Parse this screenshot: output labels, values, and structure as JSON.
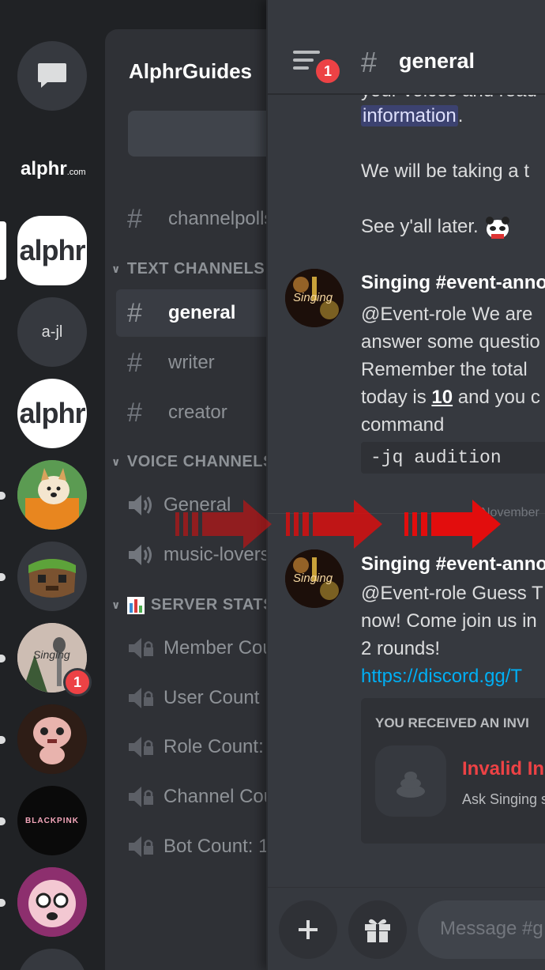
{
  "colors": {
    "accent": "#5865f2",
    "danger": "#ed4245",
    "link": "#00aff4",
    "arrow": "#e20d0d"
  },
  "rail": {
    "dm_icon": "chat-bubble-icon",
    "logo_small": "alphr",
    "logo_small_sub": ".com",
    "servers": [
      {
        "label": "alphr"
      },
      {
        "label": "a-jl"
      },
      {
        "label": "alphr"
      },
      {
        "label": ""
      },
      {
        "label": ""
      },
      {
        "label": "Singing",
        "badge": "1"
      },
      {
        "label": ""
      },
      {
        "label": "BLACKPINK"
      },
      {
        "label": ""
      }
    ]
  },
  "sidebar": {
    "guild_name": "AlphrGuides",
    "top_channel": "channelpolls",
    "categories": {
      "text": "TEXT CHANNELS",
      "voice": "VOICE CHANNELS",
      "stats": "SERVER STATS"
    },
    "text_channels": [
      "general",
      "writer",
      "creator"
    ],
    "voice_channels": [
      "General",
      "music-lovers"
    ],
    "stat_channels": [
      "Member Count",
      "User Count",
      "Role Count:",
      "Channel Count",
      "Bot Count: 1"
    ]
  },
  "chat": {
    "unread_badge": "1",
    "channel": "general",
    "messages_top": {
      "partial_line": "your voices and read",
      "information": "information",
      "period": ".",
      "line2": "We will be taking a t",
      "line3": "See y'all later."
    },
    "message1": {
      "author": "Singing #event-anno",
      "avatar_text": "Singing",
      "lines": [
        "@Event-role We are",
        "answer some questio",
        "Remember the total",
        "today is ",
        "10",
        " and you c",
        "command"
      ],
      "code": "-jq audition"
    },
    "date_divider": "November",
    "message2": {
      "author": "Singing #event-anno",
      "avatar_text": "Singing",
      "lines": [
        "@Event-role Guess T",
        "now! Come join us in",
        "2 rounds!"
      ],
      "link": "https://discord.gg/T",
      "invite": {
        "title": "YOU RECEIVED AN INVI",
        "name": "Invalid In",
        "sub": "Ask Singing s"
      }
    },
    "composer_placeholder": "Message #g"
  }
}
